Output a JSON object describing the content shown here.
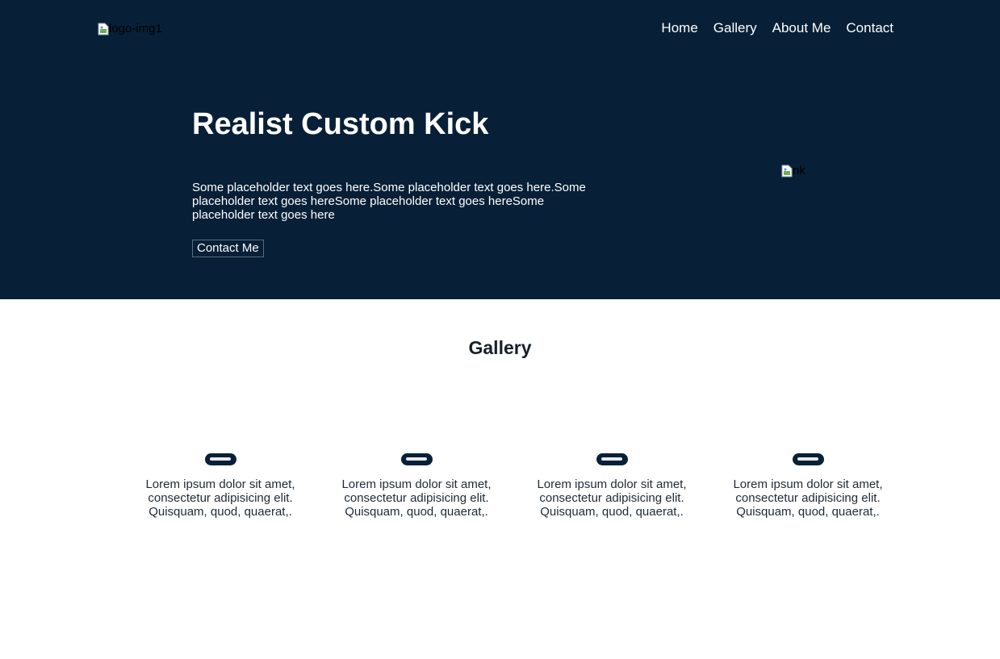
{
  "header": {
    "logo_alt": "logo-img1",
    "nav": [
      "Home",
      "Gallery",
      "About Me",
      "Contact"
    ]
  },
  "hero": {
    "title": "Realist Custom Kick",
    "text": "Some placeholder text goes here.Some placeholder text goes here.Some placeholder text goes hereSome placeholder text goes hereSome placeholder text goes here",
    "button_label": "Contact Me",
    "image_alt": "nk"
  },
  "gallery": {
    "title": "Gallery",
    "cards": [
      {
        "text": "Lorem ipsum dolor sit amet, consectetur adipisicing elit. Quisquam, quod, quaerat,."
      },
      {
        "text": "Lorem ipsum dolor sit amet, consectetur adipisicing elit. Quisquam, quod, quaerat,."
      },
      {
        "text": "Lorem ipsum dolor sit amet, consectetur adipisicing elit. Quisquam, quod, quaerat,."
      },
      {
        "text": "Lorem ipsum dolor sit amet, consectetur adipisicing elit. Quisquam, quod, quaerat,."
      }
    ]
  },
  "colors": {
    "hero_bg": "#072037",
    "page_bg": "#ffffff",
    "text_dark": "#17202b"
  },
  "icons": [
    "broken-image-icon"
  ]
}
